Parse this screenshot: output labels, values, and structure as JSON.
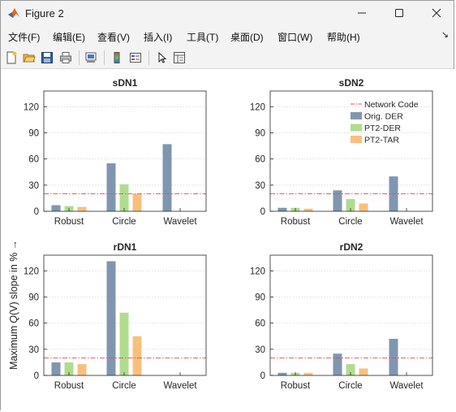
{
  "window": {
    "title": "Figure 2"
  },
  "menu": [
    "文件(F)",
    "编辑(E)",
    "查看(V)",
    "插入(I)",
    "工具(T)",
    "桌面(D)",
    "窗口(W)",
    "帮助(H)"
  ],
  "toolbar_icons": [
    "new-file-icon",
    "open-folder-icon",
    "save-icon",
    "print-icon",
    "link-axes-icon",
    "colorbar-icon",
    "legend-icon",
    "pointer-icon",
    "property-editor-icon"
  ],
  "figure": {
    "ylabel_pre": "Maximum",
    "ylabel_q": "Q",
    "ylabel_v": "(V)",
    "ylabel_post": "slope in %",
    "ylabel_arrow": "→"
  },
  "colors": {
    "network_code": "#d9534f",
    "orig_der": "#8096b0",
    "pt2_der": "#b1dc8e",
    "pt2_tar": "#f7c07f"
  },
  "legend": [
    {
      "key": "network_code",
      "label": "Network Code",
      "kind": "line"
    },
    {
      "key": "orig_der",
      "label": "Orig. DER",
      "kind": "bar"
    },
    {
      "key": "pt2_der",
      "label": "PT2-DER",
      "kind": "bar"
    },
    {
      "key": "pt2_tar",
      "label": "PT2-TAR",
      "kind": "bar"
    }
  ],
  "chart_data": [
    {
      "type": "bar",
      "title": "sDN1",
      "categories": [
        "Robust",
        "Circle",
        "Wavelet"
      ],
      "yticks": [
        0,
        30,
        60,
        90,
        120
      ],
      "ylim": [
        0,
        138
      ],
      "reference_line": 20,
      "series": [
        {
          "name": "Orig. DER",
          "values": [
            7,
            55,
            77
          ]
        },
        {
          "name": "PT2-DER",
          "values": [
            6,
            31,
            null
          ]
        },
        {
          "name": "PT2-TAR",
          "values": [
            5,
            20,
            null
          ]
        }
      ],
      "grid": true,
      "legend": false
    },
    {
      "type": "bar",
      "title": "sDN2",
      "categories": [
        "Robust",
        "Circle",
        "Wavelet"
      ],
      "yticks": [
        0,
        30,
        60,
        90,
        120
      ],
      "ylim": [
        0,
        138
      ],
      "reference_line": 20,
      "series": [
        {
          "name": "Orig. DER",
          "values": [
            4,
            24,
            40
          ]
        },
        {
          "name": "PT2-DER",
          "values": [
            4,
            14,
            null
          ]
        },
        {
          "name": "PT2-TAR",
          "values": [
            3,
            9,
            null
          ]
        }
      ],
      "grid": true,
      "legend": true,
      "legend_position": "top-right"
    },
    {
      "type": "bar",
      "title": "rDN1",
      "categories": [
        "Robust",
        "Circle",
        "Wavelet"
      ],
      "yticks": [
        0,
        30,
        60,
        90,
        120
      ],
      "ylim": [
        0,
        138
      ],
      "reference_line": 20,
      "series": [
        {
          "name": "Orig. DER",
          "values": [
            15,
            131,
            null
          ]
        },
        {
          "name": "PT2-DER",
          "values": [
            15,
            72,
            null
          ]
        },
        {
          "name": "PT2-TAR",
          "values": [
            13,
            45,
            null
          ]
        }
      ],
      "grid": true,
      "legend": false
    },
    {
      "type": "bar",
      "title": "rDN2",
      "categories": [
        "Robust",
        "Circle",
        "Wavelet"
      ],
      "yticks": [
        0,
        30,
        60,
        90,
        120
      ],
      "ylim": [
        0,
        138
      ],
      "reference_line": 20,
      "series": [
        {
          "name": "Orig. DER",
          "values": [
            3,
            25,
            42
          ]
        },
        {
          "name": "PT2-DER",
          "values": [
            3,
            13,
            null
          ]
        },
        {
          "name": "PT2-TAR",
          "values": [
            3,
            8,
            null
          ]
        }
      ],
      "grid": true,
      "legend": false
    }
  ]
}
